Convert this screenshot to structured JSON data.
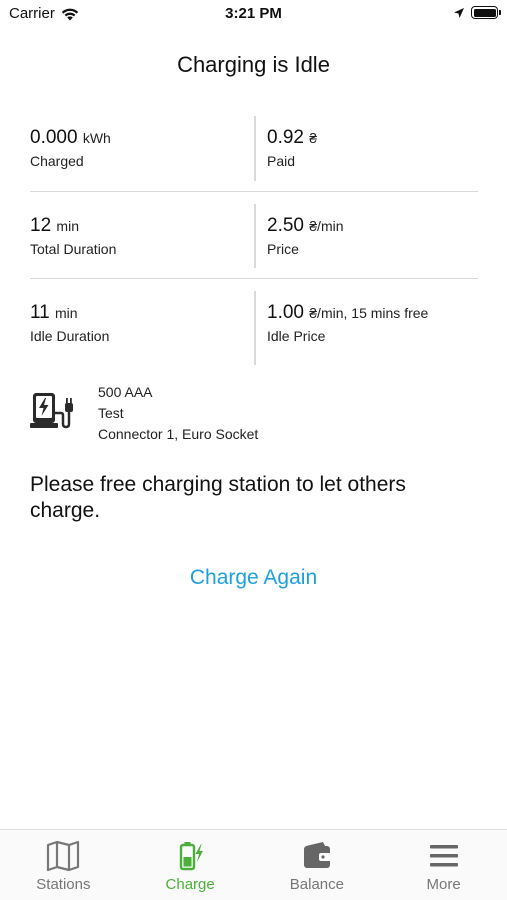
{
  "status_bar": {
    "carrier": "Carrier",
    "time": "3:21 PM"
  },
  "title": "Charging is Idle",
  "stats": [
    {
      "left": {
        "value": "0.000",
        "unit": "kWh",
        "caption": "Charged"
      },
      "right": {
        "value": "0.92",
        "unit": "₴",
        "caption": "Paid"
      }
    },
    {
      "left": {
        "value": "12",
        "unit": "min",
        "caption": "Total Duration"
      },
      "right": {
        "value": "2.50",
        "unit": "₴/min",
        "caption": "Price"
      }
    },
    {
      "left": {
        "value": "11",
        "unit": "min",
        "caption": "Idle Duration"
      },
      "right": {
        "value": "1.00",
        "unit": "₴/min, 15 mins free",
        "caption": "Idle Price"
      }
    }
  ],
  "station": {
    "icon": "charging-station-icon",
    "line1": "500 AAA",
    "line2": "Test",
    "line3": "Connector 1, Euro Socket"
  },
  "message": "Please free charging station to let others charge.",
  "charge_again_label": "Charge Again",
  "tabs": [
    {
      "label": "Stations",
      "icon": "map-icon",
      "active": false
    },
    {
      "label": "Charge",
      "icon": "battery-charge-icon",
      "active": true
    },
    {
      "label": "Balance",
      "icon": "wallet-icon",
      "active": false
    },
    {
      "label": "More",
      "icon": "menu-icon",
      "active": false
    }
  ],
  "colors": {
    "accent_blue": "#1ea0e0",
    "active_tab": "#4caf3a",
    "inactive_tab": "#777777"
  }
}
